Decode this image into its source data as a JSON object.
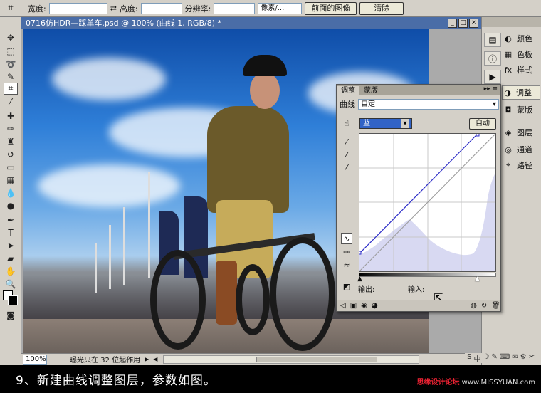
{
  "options_bar": {
    "tool_icon": "crop-icon",
    "width_label": "宽度:",
    "swap_icon": "swap-arrows-icon",
    "height_label": "高度:",
    "resolution_label": "分辨率:",
    "unit_select": "像素/...",
    "front_image_button": "前面的图像",
    "clear_button": "清除"
  },
  "document": {
    "title": "0716仿HDR—踩单车.psd @ 100% (曲线 1, RGB/8) *",
    "zoom": "100%",
    "status_text": "曝光只在 32 位起作用"
  },
  "dock": {
    "panels": [
      {
        "label": "颜色",
        "icon": "color-icon"
      },
      {
        "label": "色板",
        "icon": "swatches-icon"
      },
      {
        "label": "样式",
        "icon": "styles-icon"
      },
      {
        "label": "调整",
        "icon": "adjustments-icon"
      },
      {
        "label": "蒙版",
        "icon": "masks-icon"
      },
      {
        "label": "图层",
        "icon": "layers-icon"
      },
      {
        "label": "通道",
        "icon": "channels-icon"
      },
      {
        "label": "路径",
        "icon": "paths-icon"
      }
    ]
  },
  "adjustments_panel": {
    "tabs": [
      "调整",
      "蒙版"
    ],
    "active_tab": "调整",
    "type_label": "曲线",
    "preset": "自定",
    "channel": "蓝",
    "auto_button": "自动",
    "output_label": "输出:",
    "input_label": "输入:",
    "curve_color": "#2c2cc8",
    "histogram_color": "#d8d9f2"
  },
  "caption": {
    "text": "9、新建曲线调整图层，参数如图。",
    "watermark_left": "思缘设计论坛",
    "watermark_right": "www.MISSYUAN.com"
  },
  "taskbar": {
    "icons": [
      "S",
      "中",
      "☽",
      "✎",
      "⌨",
      "✉",
      "⚙",
      "✂"
    ]
  }
}
